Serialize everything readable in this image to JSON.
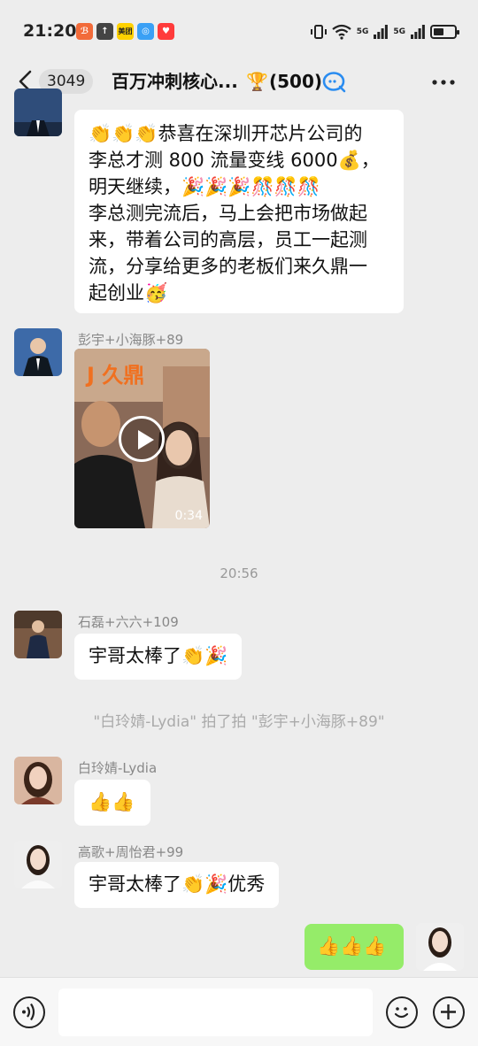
{
  "status_bar": {
    "time": "21:20",
    "app_badges": [
      "ℬ",
      "↑",
      "美团",
      "◎",
      "♥"
    ],
    "network": "5G",
    "network2": "5G",
    "battery_level": 0.5
  },
  "header": {
    "unread_count": "3049",
    "title": "百万冲刺核心...",
    "trophy": "🏆",
    "member_count": "(500)"
  },
  "messages": {
    "m1": {
      "lines": [
        "👏👏👏恭喜在深圳开芯片公司的",
        "李总才测 800 流量变线 6000💰，",
        "明天继续，🎉🎉🎉🎊🎊🎊",
        "李总测完流后，马上会把市场做起",
        "来，带着公司的高层，员工一起测",
        "流，分享给更多的老板们来久鼎一",
        "起创业🥳"
      ]
    },
    "m2": {
      "sender": "彭宇+小海豚+89",
      "video_logo": "J 久鼎",
      "duration": "0:34"
    },
    "time_separator": "20:56",
    "m3": {
      "sender": "石磊+六六+109",
      "text": "宇哥太棒了👏🎉"
    },
    "system_notice": "\"白玲婧-Lydia\" 拍了拍 \"彭宇+小海豚+89\"",
    "m4": {
      "sender": "白玲婧-Lydia",
      "text": "👍👍"
    },
    "m5": {
      "sender": "高歌+周怡君+99",
      "text": "宇哥太棒了👏🎉优秀"
    },
    "m6": {
      "text": "👍👍👍"
    }
  },
  "colors": {
    "background": "#ededed",
    "self_bubble": "#95ec69",
    "other_bubble": "#ffffff"
  },
  "icons": [
    "back-icon",
    "qq-icon",
    "more-icon",
    "voice-icon",
    "emoji-icon",
    "plus-icon",
    "play-icon"
  ]
}
